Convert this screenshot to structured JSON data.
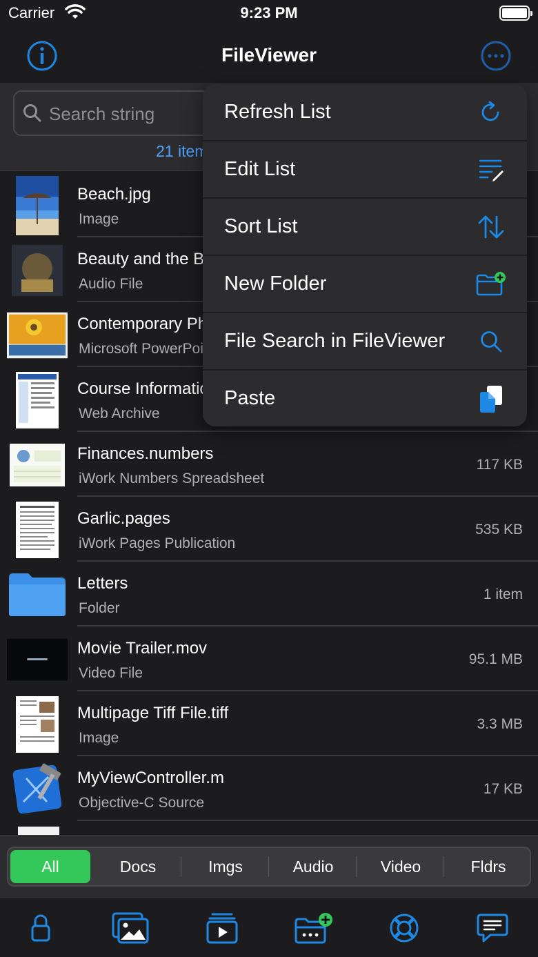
{
  "status_bar": {
    "carrier": "Carrier",
    "time": "9:23 PM"
  },
  "nav": {
    "title": "FileViewer",
    "info_icon": "info-icon",
    "more_icon": "ellipsis-circle-icon"
  },
  "search": {
    "placeholder": "Search string",
    "count": "21 items"
  },
  "files": [
    {
      "name": "Beach.jpg",
      "type": "Image",
      "size": ""
    },
    {
      "name": "Beauty and the Beast",
      "type": "Audio File",
      "size": ""
    },
    {
      "name": "Contemporary Photo Album",
      "type": "Microsoft PowerPoint",
      "size": ""
    },
    {
      "name": "Course Information",
      "type": "Web Archive",
      "size": ""
    },
    {
      "name": "Finances.numbers",
      "type": "iWork Numbers Spreadsheet",
      "size": "117 KB"
    },
    {
      "name": "Garlic.pages",
      "type": "iWork Pages Publication",
      "size": "535 KB"
    },
    {
      "name": "Letters",
      "type": "Folder",
      "size": "1 item"
    },
    {
      "name": "Movie Trailer.mov",
      "type": "Video File",
      "size": "95.1 MB"
    },
    {
      "name": "Multipage Tiff File.tiff",
      "type": "Image",
      "size": "3.3 MB"
    },
    {
      "name": "MyViewController.m",
      "type": "Objective-C Source",
      "size": "17 KB"
    }
  ],
  "menu": [
    {
      "label": "Refresh List",
      "icon": "refresh-icon"
    },
    {
      "label": "Edit List",
      "icon": "edit-list-icon"
    },
    {
      "label": "Sort List",
      "icon": "sort-icon"
    },
    {
      "label": "New Folder",
      "icon": "new-folder-icon"
    },
    {
      "label": "File Search in FileViewer",
      "icon": "search-icon"
    },
    {
      "label": "Paste",
      "icon": "paste-icon"
    }
  ],
  "filters": [
    "All",
    "Docs",
    "Imgs",
    "Audio",
    "Video",
    "Fldrs"
  ],
  "active_filter": "All",
  "tabs": [
    "lock-icon",
    "photos-icon",
    "play-icon",
    "add-folder-icon",
    "lifebuoy-icon",
    "message-icon"
  ],
  "colors": {
    "accent": "#1e88e5",
    "active_segment": "#34c759",
    "background": "#1c1c1e"
  }
}
